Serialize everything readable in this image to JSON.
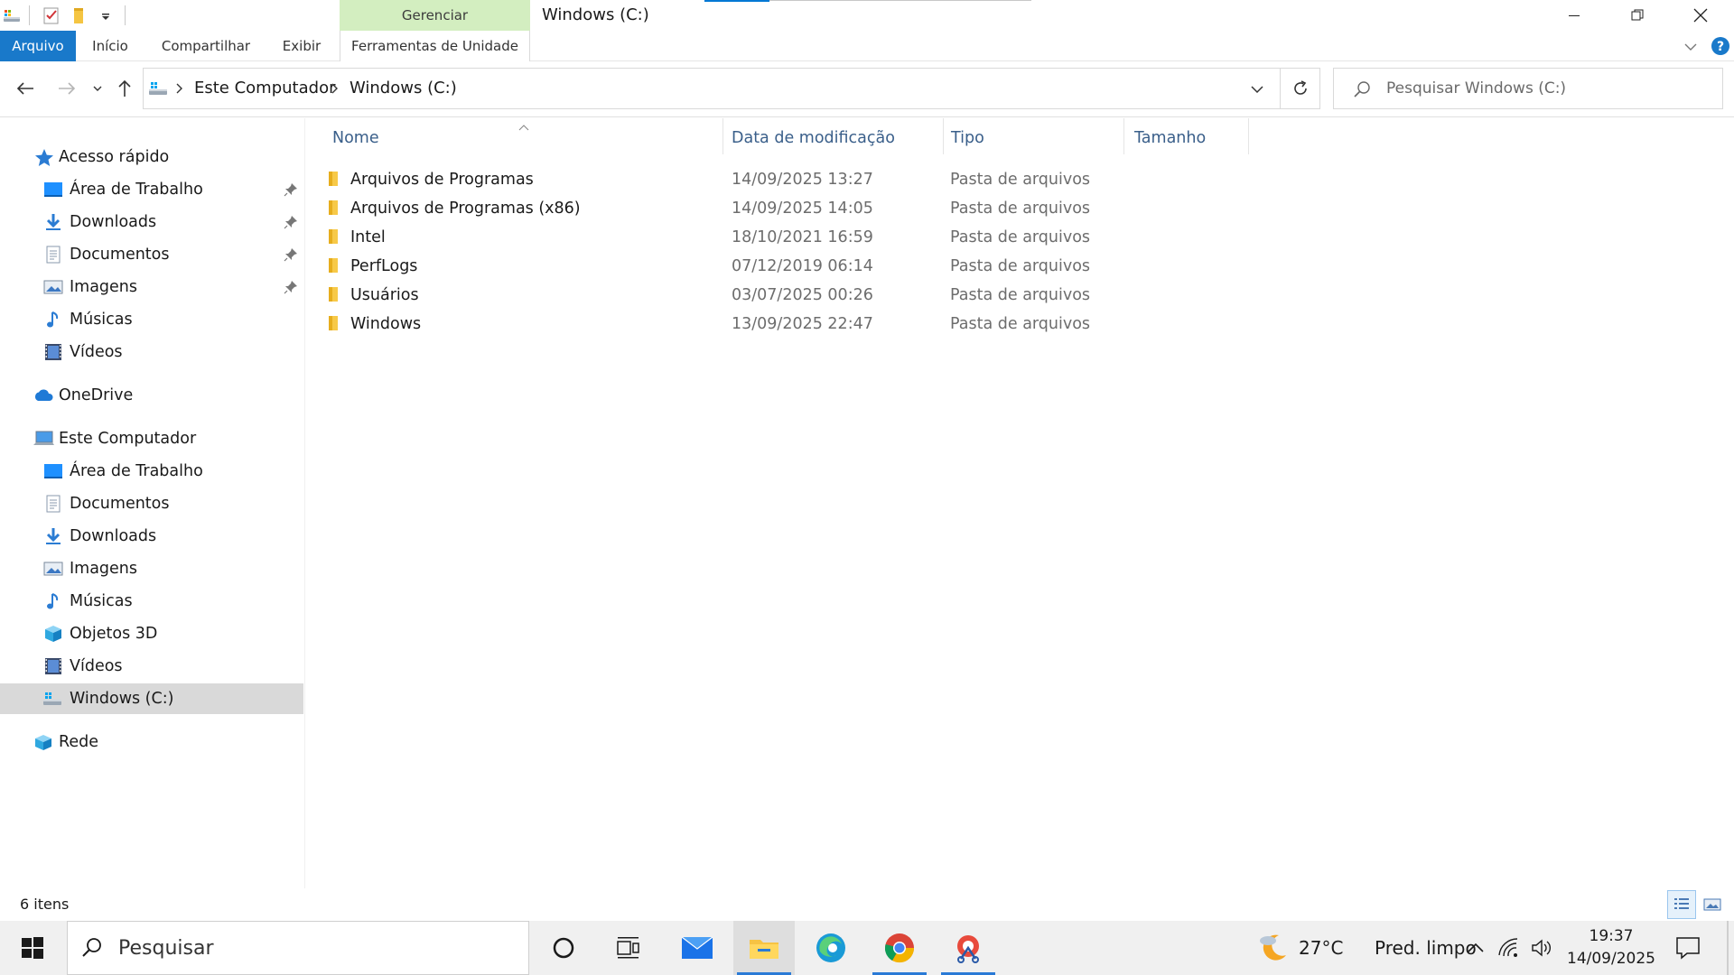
{
  "window": {
    "title": "Windows (C:)",
    "context_tab_header": "Gerenciar"
  },
  "ribbon": {
    "tabs": [
      "Arquivo",
      "Início",
      "Compartilhar",
      "Exibir",
      "Ferramentas de Unidade"
    ],
    "active_tab": "Arquivo",
    "accent_color": "#1979ca",
    "context_color": "#d3eec0"
  },
  "address": {
    "crumbs": [
      "Este Computador",
      "Windows (C:)"
    ],
    "separator": ">"
  },
  "search": {
    "placeholder": "Pesquisar Windows (C:)"
  },
  "nav_pane": {
    "quick_access": {
      "label": "Acesso rápido",
      "items": [
        {
          "label": "Área de Trabalho",
          "icon": "desktop-icon",
          "pinned": true
        },
        {
          "label": "Downloads",
          "icon": "download-icon",
          "pinned": true
        },
        {
          "label": "Documentos",
          "icon": "document-icon",
          "pinned": true
        },
        {
          "label": "Imagens",
          "icon": "pictures-icon",
          "pinned": true
        },
        {
          "label": "Músicas",
          "icon": "music-icon",
          "pinned": false
        },
        {
          "label": "Vídeos",
          "icon": "videos-icon",
          "pinned": false
        }
      ]
    },
    "onedrive": {
      "label": "OneDrive"
    },
    "this_pc": {
      "label": "Este Computador",
      "items": [
        {
          "label": "Área de Trabalho",
          "icon": "desktop-icon"
        },
        {
          "label": "Documentos",
          "icon": "document-icon"
        },
        {
          "label": "Downloads",
          "icon": "download-icon"
        },
        {
          "label": "Imagens",
          "icon": "pictures-icon"
        },
        {
          "label": "Músicas",
          "icon": "music-icon"
        },
        {
          "label": "Objetos 3D",
          "icon": "3d-objects-icon"
        },
        {
          "label": "Vídeos",
          "icon": "videos-icon"
        },
        {
          "label": "Windows (C:)",
          "icon": "drive-icon",
          "selected": true
        }
      ]
    },
    "network": {
      "label": "Rede"
    }
  },
  "file_list": {
    "columns": [
      "Nome",
      "Data de modificação",
      "Tipo",
      "Tamanho"
    ],
    "rows": [
      {
        "name": "Arquivos de Programas",
        "date": "14/09/2025 13:27",
        "type": "Pasta de arquivos"
      },
      {
        "name": "Arquivos de Programas (x86)",
        "date": "14/09/2025 14:05",
        "type": "Pasta de arquivos"
      },
      {
        "name": "Intel",
        "date": "18/10/2021 16:59",
        "type": "Pasta de arquivos"
      },
      {
        "name": "PerfLogs",
        "date": "07/12/2019 06:14",
        "type": "Pasta de arquivos"
      },
      {
        "name": "Usuários",
        "date": "03/07/2025 00:26",
        "type": "Pasta de arquivos"
      },
      {
        "name": "Windows",
        "date": "13/09/2025 22:47",
        "type": "Pasta de arquivos"
      }
    ]
  },
  "status": {
    "item_count": "6 itens"
  },
  "taskbar": {
    "search_placeholder": "Pesquisar",
    "weather_temp": "27°C",
    "weather_desc": "Pred. limpo",
    "time": "19:37",
    "date": "14/09/2025"
  }
}
